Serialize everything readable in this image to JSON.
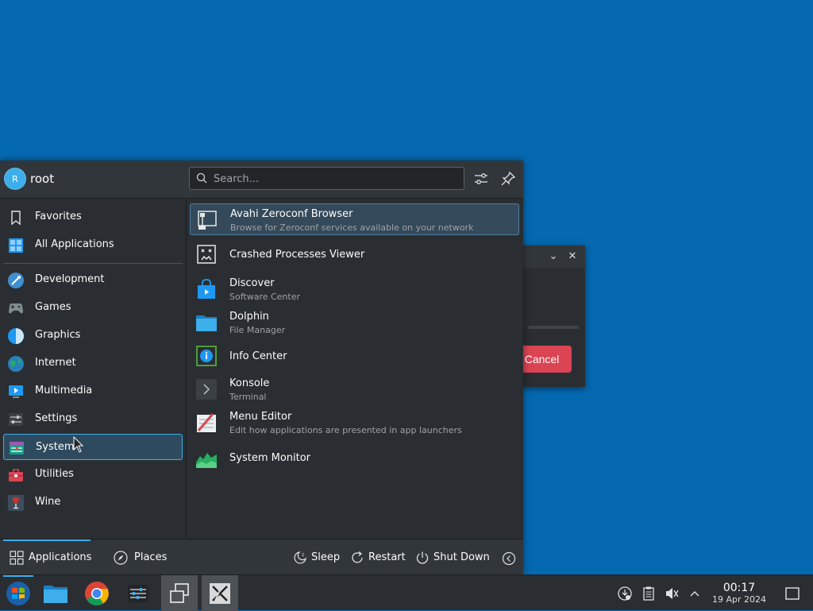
{
  "user": {
    "initial": "R",
    "name": "root"
  },
  "search": {
    "placeholder": "Search..."
  },
  "sidebar": {
    "top_items": [
      {
        "label": "Favorites"
      },
      {
        "label": "All Applications"
      }
    ],
    "categories": [
      {
        "label": "Development"
      },
      {
        "label": "Games"
      },
      {
        "label": "Graphics"
      },
      {
        "label": "Internet"
      },
      {
        "label": "Multimedia"
      },
      {
        "label": "Settings"
      },
      {
        "label": "System"
      },
      {
        "label": "Utilities"
      },
      {
        "label": "Wine"
      }
    ]
  },
  "apps": [
    {
      "name": "Avahi Zeroconf Browser",
      "desc": "Browse for Zeroconf services available on your network"
    },
    {
      "name": "Crashed Processes Viewer",
      "desc": ""
    },
    {
      "name": "Discover",
      "desc": "Software Center"
    },
    {
      "name": "Dolphin",
      "desc": "File Manager"
    },
    {
      "name": "Info Center",
      "desc": ""
    },
    {
      "name": "Konsole",
      "desc": "Terminal"
    },
    {
      "name": "Menu Editor",
      "desc": "Edit how applications are presented in app launchers"
    },
    {
      "name": "System Monitor",
      "desc": ""
    }
  ],
  "footer": {
    "tabs": [
      {
        "label": "Applications"
      },
      {
        "label": "Places"
      }
    ],
    "actions": [
      {
        "label": "Sleep"
      },
      {
        "label": "Restart"
      },
      {
        "label": "Shut Down"
      }
    ]
  },
  "dialog": {
    "cancel_label": "Cancel"
  },
  "clock": {
    "time": "00:17",
    "date": "19 Apr 2024"
  },
  "colors": {
    "accent": "#3daee9",
    "desktop": "#0469b1",
    "panel": "#2a2e32",
    "cancel": "#da4453"
  }
}
